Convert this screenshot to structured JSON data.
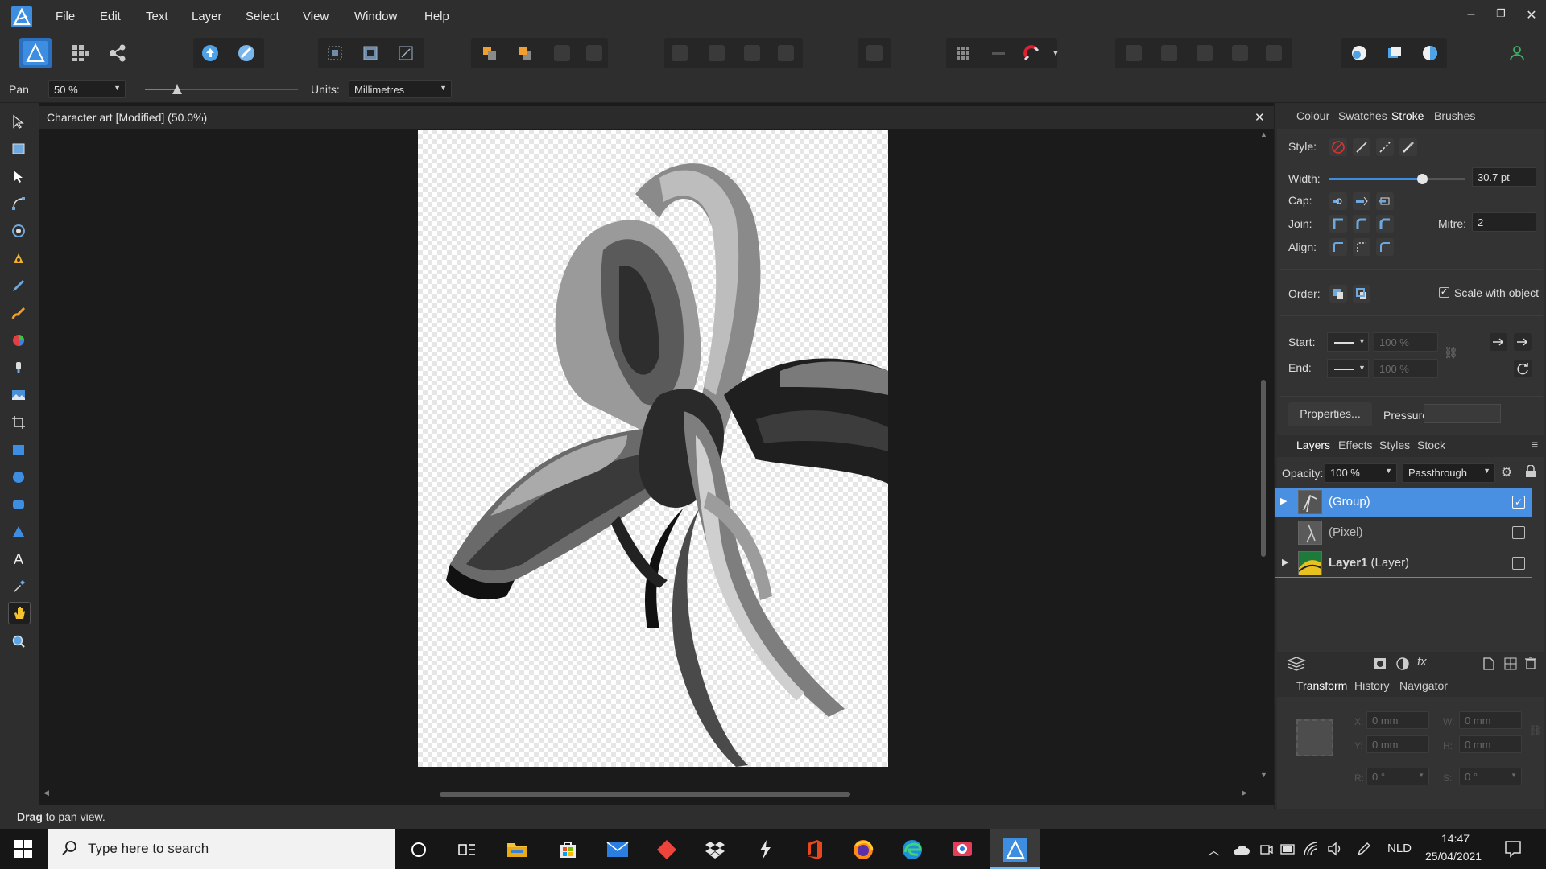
{
  "menu": [
    "File",
    "Edit",
    "Text",
    "Layer",
    "Select",
    "View",
    "Window",
    "Help"
  ],
  "window_controls": {
    "minimize": "–",
    "restore": "❐",
    "close": "✕"
  },
  "context": {
    "tool_name": "Pan",
    "zoom_value": "50 %",
    "units_label": "Units:",
    "units_value": "Millimetres"
  },
  "document": {
    "title": "Character art [Modified] (50.0%)",
    "close": "✕"
  },
  "panel_top": {
    "tabs": [
      "Colour",
      "Swatches",
      "Stroke",
      "Brushes"
    ],
    "active_tab": "Stroke",
    "style_label": "Style:",
    "width_label": "Width:",
    "width_value": "30.7 pt",
    "width_level": 0.68,
    "cap_label": "Cap:",
    "join_label": "Join:",
    "mitre_label": "Mitre:",
    "mitre_value": "2",
    "align_label": "Align:",
    "order_label": "Order:",
    "scale_label": "Scale with object",
    "scale_checked": true,
    "start_label": "Start:",
    "end_label": "End:",
    "start_pct": "100 %",
    "end_pct": "100 %",
    "properties_button": "Properties...",
    "pressure_label": "Pressure:"
  },
  "layers_panel": {
    "tabs": [
      "Layers",
      "Effects",
      "Styles",
      "Stock"
    ],
    "active_tab": "Layers",
    "opacity_label": "Opacity:",
    "opacity_value": "100 %",
    "blend_mode": "Passthrough",
    "layers": [
      {
        "name": "(Group)",
        "selected": true,
        "checked": true,
        "expand": "▶"
      },
      {
        "name": "(Pixel)",
        "selected": false,
        "checked": false,
        "expand": ""
      },
      {
        "name_bold": "Layer1",
        "name_rest": " (Layer)",
        "selected": false,
        "checked": false,
        "expand": "▶"
      }
    ]
  },
  "panel_bottom": {
    "tabs": [
      "Transform",
      "History",
      "Navigator"
    ],
    "active_tab": "Transform",
    "x_label": "X:",
    "y_label": "Y:",
    "w_label": "W:",
    "h_label": "H:",
    "r_label": "R:",
    "s_label": "S:",
    "x_value": "0 mm",
    "y_value": "0 mm",
    "w_value": "0 mm",
    "h_value": "0 mm",
    "r_value": "0 °",
    "s_value": "0 °"
  },
  "status": {
    "bold": "Drag",
    "rest": " to pan view."
  },
  "taskbar": {
    "search_placeholder": "Type here to search",
    "language": "NLD",
    "time": "14:47",
    "date": "25/04/2021"
  },
  "colors": {
    "accent": "#3d8ee0",
    "selected_row": "#4a90e2",
    "background": "#2e2e2e"
  }
}
